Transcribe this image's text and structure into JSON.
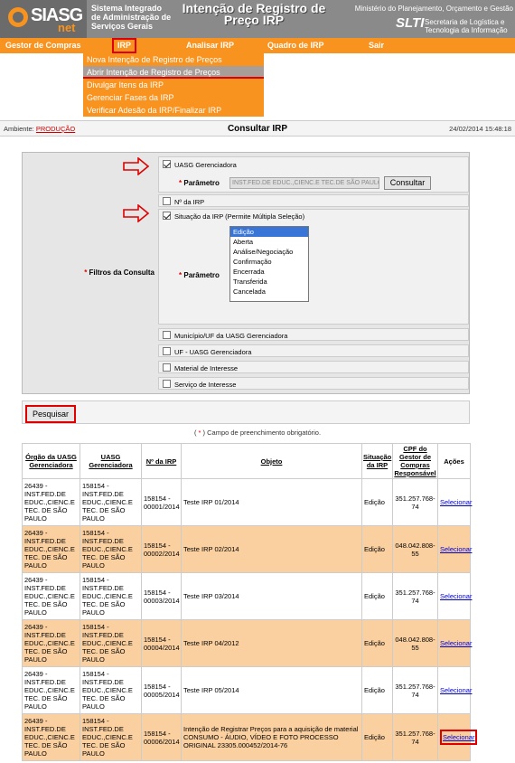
{
  "header": {
    "logo_text": "SIASG",
    "logo_suffix": "net",
    "system_name": "Sistema Integrado de Administração de Serviços Gerais",
    "page_title": "Intenção de Registro de Preço IRP",
    "ministry": "Ministério do Planejamento, Orçamento e Gestão",
    "slti": "SLTI",
    "secretaria": "Secretaria de Logística e Tecnologia da Informação"
  },
  "menu": {
    "items": [
      "Gestor de Compras",
      "IRP",
      "Analisar IRP",
      "Quadro de IRP",
      "Sair"
    ],
    "dropdown": [
      "Nova Intenção de Registro de Preços",
      "Abrir Intenção de Registro de Preços",
      "Divulgar Itens da IRP",
      "Gerenciar Fases da IRP",
      "Verificar Adesão da IRP/Finalizar IRP"
    ]
  },
  "status_bar": {
    "ambiente_label": "Ambiente:",
    "ambiente_value": "PRODUÇÃO",
    "title": "Consultar IRP",
    "datetime": "24/02/2014 15:48:18"
  },
  "filters": {
    "label": "Filtros da Consulta",
    "req_mark": "*",
    "uasg_gerenciadora": "UASG Gerenciadora",
    "parametro_label": "Parâmetro",
    "parametro_value": "INST.FED.DE EDUC.,CIENC.E TEC.DE SÃO PAULO",
    "consultar_button": "Consultar",
    "numero_irp": "Nº da IRP",
    "situacao_irp": "Situação da IRP (Permite Múltipla Seleção)",
    "situacao_options": [
      "Edição",
      "Aberta",
      "Análise/Negociação",
      "Confirmação",
      "Encerrada",
      "Transferida",
      "Cancelada"
    ],
    "municipio": "Município/UF da UASG Gerenciadora",
    "uf": "UF - UASG Gerenciadora",
    "material": "Material de Interesse",
    "servico": "Serviço de Interesse"
  },
  "search": {
    "button": "Pesquisar",
    "required_note_open": "(",
    "required_note_mark": "*",
    "required_note_text": ") Campo de preenchimento obrigatório."
  },
  "table": {
    "columns": [
      "Órgão da UASG Gerenciadora",
      "UASG Gerenciadora",
      "Nº da IRP",
      "Objeto",
      "Situação da IRP",
      "CPF do Gestor de Compras Responsável",
      "Ações"
    ],
    "rows": [
      {
        "orgao": "26439 - INST.FED.DE EDUC.,CIENC.E TEC. DE SÃO PAULO",
        "uasg": "158154 - INST.FED.DE EDUC.,CIENC.E TEC. DE SÃO PAULO",
        "numero": "158154 - 00001/2014",
        "objeto": "Teste IRP 01/2014",
        "situacao": "Edição",
        "cpf": "351.257.768-74",
        "acao": "Selecionar"
      },
      {
        "orgao": "26439 - INST.FED.DE EDUC.,CIENC.E TEC. DE SÃO PAULO",
        "uasg": "158154 - INST.FED.DE EDUC.,CIENC.E TEC. DE SÃO PAULO",
        "numero": "158154 - 00002/2014",
        "objeto": "Teste IRP 02/2014",
        "situacao": "Edição",
        "cpf": "048.042.808-55",
        "acao": "Selecionar"
      },
      {
        "orgao": "26439 - INST.FED.DE EDUC.,CIENC.E TEC. DE SÃO PAULO",
        "uasg": "158154 - INST.FED.DE EDUC.,CIENC.E TEC. DE SÃO PAULO",
        "numero": "158154 - 00003/2014",
        "objeto": "Teste IRP 03/2014",
        "situacao": "Edição",
        "cpf": "351.257.768-74",
        "acao": "Selecionar"
      },
      {
        "orgao": "26439 - INST.FED.DE EDUC.,CIENC.E TEC. DE SÃO PAULO",
        "uasg": "158154 - INST.FED.DE EDUC.,CIENC.E TEC. DE SÃO PAULO",
        "numero": "158154 - 00004/2014",
        "objeto": "Teste IRP 04/2012",
        "situacao": "Edição",
        "cpf": "048.042.808-55",
        "acao": "Selecionar"
      },
      {
        "orgao": "26439 - INST.FED.DE EDUC.,CIENC.E TEC. DE SÃO PAULO",
        "uasg": "158154 - INST.FED.DE EDUC.,CIENC.E TEC. DE SÃO PAULO",
        "numero": "158154 - 00005/2014",
        "objeto": "Teste IRP 05/2014",
        "situacao": "Edição",
        "cpf": "351.257.768-74",
        "acao": "Selecionar"
      },
      {
        "orgao": "26439 - INST.FED.DE EDUC.,CIENC.E TEC. DE SÃO PAULO",
        "uasg": "158154 - INST.FED.DE EDUC.,CIENC.E TEC. DE SÃO PAULO",
        "numero": "158154 - 00006/2014",
        "objeto": "Intenção de Registrar Preços para a aquisição de material CONSUMO - ÁUDIO, VÍDEO E FOTO PROCESSO ORIGINAL 23305.000452/2014-76",
        "situacao": "Edição",
        "cpf": "351.257.768-74",
        "acao": "Selecionar"
      }
    ]
  }
}
